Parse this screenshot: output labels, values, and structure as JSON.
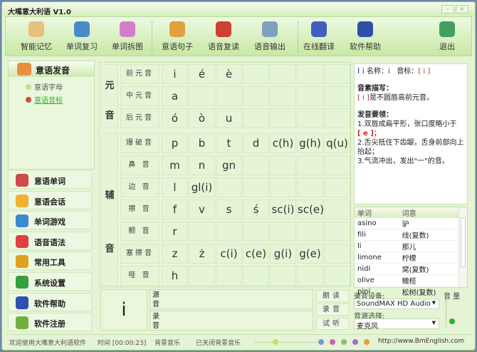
{
  "window": {
    "title": "大嘴意大利语 V1.0"
  },
  "toolbar": [
    {
      "label": "智能记忆",
      "icon": "book-icon",
      "color": "#e8c080"
    },
    {
      "label": "单词复习",
      "icon": "notebook-icon",
      "color": "#4a8ac8"
    },
    {
      "label": "单词拆图",
      "icon": "grid-picture-icon",
      "color": "#d080c8"
    },
    {
      "label": "意语句子",
      "icon": "people-icon",
      "color": "#e0a040"
    },
    {
      "label": "语音复读",
      "icon": "speaker-person-icon",
      "color": "#d04030"
    },
    {
      "label": "语音输出",
      "icon": "microphone-icon",
      "color": "#80a0c0"
    },
    {
      "label": "在线翻译",
      "icon": "refresh-icon",
      "color": "#4060c0"
    },
    {
      "label": "软件帮助",
      "icon": "help-icon",
      "color": "#3050a8"
    },
    {
      "label": "退出",
      "icon": "exit-door-icon",
      "color": "#40a060"
    }
  ],
  "sidebar": {
    "header": "意语发音",
    "sub_items": [
      "意语字母",
      "意语音标"
    ],
    "buttons": [
      {
        "label": "意语单词",
        "icon": "words-icon",
        "color": "#d04848"
      },
      {
        "label": "意语会话",
        "icon": "chat-icon",
        "color": "#f0b030"
      },
      {
        "label": "单词游戏",
        "icon": "game-icon",
        "color": "#3a8ad0"
      },
      {
        "label": "语音语法",
        "icon": "abc-icon",
        "color": "#e04040"
      },
      {
        "label": "常用工具",
        "icon": "tools-icon",
        "color": "#e0a020"
      },
      {
        "label": "系统设置",
        "icon": "settings-icon",
        "color": "#30a040"
      },
      {
        "label": "软件帮助",
        "icon": "help-icon",
        "color": "#3050b0"
      },
      {
        "label": "软件注册",
        "icon": "register-icon",
        "color": "#70b040"
      }
    ]
  },
  "grid": {
    "groups": [
      {
        "label_top": "元",
        "label_bottom": "音",
        "rows": [
          {
            "label": "前元音",
            "cells": [
              "i",
              "é",
              "è"
            ]
          },
          {
            "label": "中元音",
            "cells": [
              "a"
            ]
          },
          {
            "label": "后元音",
            "cells": [
              "ó",
              "ò",
              "u"
            ]
          }
        ]
      },
      {
        "label_top": "辅",
        "label_bottom": "音",
        "rows": [
          {
            "label": "爆破音",
            "cells": [
              "p",
              "b",
              "t",
              "d",
              "c(h)",
              "g(h)",
              "q(u)"
            ]
          },
          {
            "label": "鼻 音",
            "cells": [
              "m",
              "n",
              "gn"
            ]
          },
          {
            "label": "边 音",
            "cells": [
              "l",
              "gl(i)"
            ]
          },
          {
            "label": "擦 音",
            "cells": [
              "f",
              "v",
              "s",
              "ś",
              "sc(i)",
              "sc(e)"
            ]
          },
          {
            "label": "颤 音",
            "cells": [
              "r"
            ]
          },
          {
            "label": "塞擦音",
            "cells": [
              "z",
              "ż",
              "c(i)",
              "c(e)",
              "g(i)",
              "g(e)"
            ]
          },
          {
            "label": "哑 音",
            "cells": [
              "h"
            ]
          }
        ]
      }
    ]
  },
  "info": {
    "letters": "I i",
    "name_label": "名称：",
    "name": "i",
    "phonetic_label": "音标：",
    "phonetic": "[ i ]",
    "desc_title": "音素描写：",
    "desc_symbol": "[ i ]",
    "desc": "是不圆唇高前元音。",
    "tips_title": "发音要领：",
    "tip1": "1.双唇成扁平形，张口度略小于",
    "tip1_symbol": "[ e ]",
    "tip1_end": "；",
    "tip2": "2.舌尖抵住下齿龈，舌身前部向上抬起；",
    "tip3": "3.气流冲出，发出\"一\"的音。"
  },
  "word_list": {
    "headers": [
      "单词",
      "词意"
    ],
    "rows": [
      [
        "asino",
        "驴"
      ],
      [
        "fili",
        "线(复数)"
      ],
      [
        "li",
        "那儿"
      ],
      [
        "limone",
        "柠檬"
      ],
      [
        "nidi",
        "窝(复数)"
      ],
      [
        "olive",
        "橄榄"
      ],
      [
        "pini",
        "松树(复数)"
      ]
    ]
  },
  "recording": {
    "device_label": "录音设备:",
    "device": "SoundMAX HD Audio",
    "source_label": "音源选择:",
    "source": "麦克风",
    "volume_label": "音 量"
  },
  "practice": {
    "symbol": "i",
    "source_label": "源\n音",
    "record_label": "录\n音",
    "source_label_1": "源",
    "source_label_2": "音",
    "record_label_1": "录",
    "record_label_2": "音",
    "buttons": [
      "朗读",
      "录音",
      "试听"
    ]
  },
  "status": {
    "welcome": "欢迎使用大嘴意大利语软件",
    "time": "时间 [00:00:23]",
    "bgm_label": "背景音乐",
    "bgm_status": "已关闭背景音乐",
    "url": "http://www.BmEnglish.com"
  }
}
